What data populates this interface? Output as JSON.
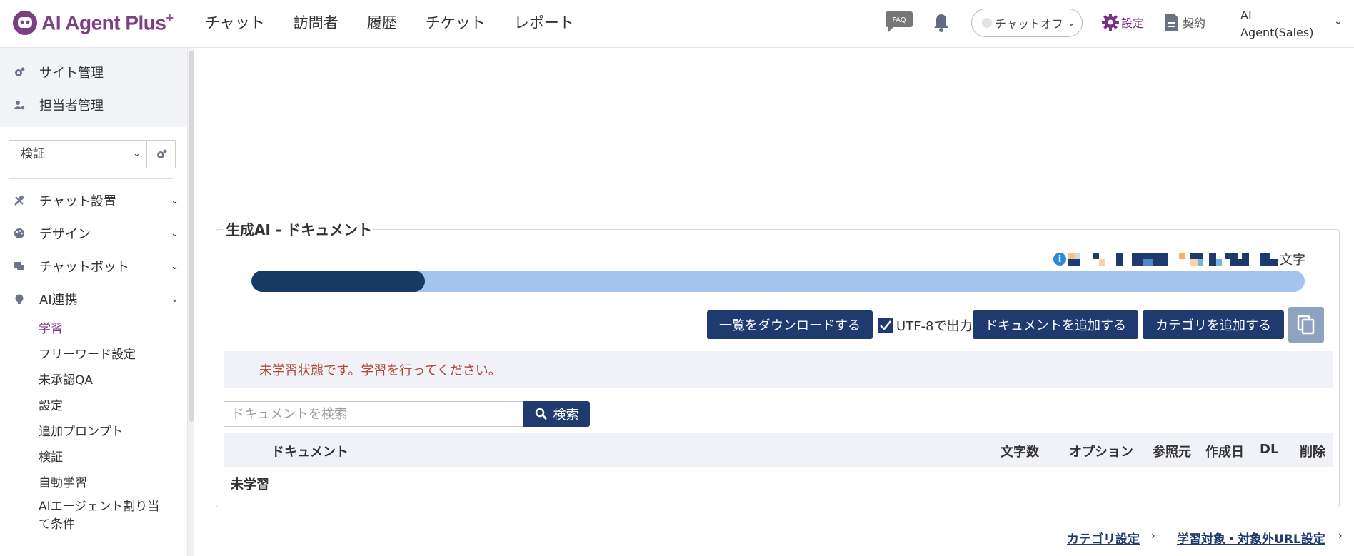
{
  "header": {
    "logo_text": "AI Agent Plus",
    "logo_sup": "+",
    "nav": [
      "チャット",
      "訪問者",
      "履歴",
      "チケット",
      "レポート"
    ],
    "faq_label": "FAQ",
    "chat_status": "チャットオフ",
    "settings_label": "設定",
    "contract_label": "契約",
    "user_line1": "AI",
    "user_line2": "Agent(Sales)"
  },
  "sidebar": {
    "top_items": [
      {
        "label": "サイト管理",
        "icon": "gear-cog-icon"
      },
      {
        "label": "担当者管理",
        "icon": "user-gear-icon"
      }
    ],
    "site_select_value": "検証",
    "sections": [
      {
        "label": "チャット設置",
        "icon": "tools-icon"
      },
      {
        "label": "デザイン",
        "icon": "palette-icon"
      },
      {
        "label": "チャットボット",
        "icon": "chat-bubbles-icon"
      },
      {
        "label": "AI連携",
        "icon": "bulb-icon"
      }
    ],
    "ai_sub_items": [
      {
        "label": "学習",
        "active": true
      },
      {
        "label": "フリーワード設定",
        "active": false
      },
      {
        "label": "未承認QA",
        "active": false
      },
      {
        "label": "設定",
        "active": false
      },
      {
        "label": "追加プロンプト",
        "active": false
      },
      {
        "label": "検証",
        "active": false
      },
      {
        "label": "自動学習",
        "active": false
      },
      {
        "label": "AIエージェント割り当\nて条件",
        "active": false
      }
    ]
  },
  "main": {
    "section_title": "生成AI - ドキュメント",
    "usage_suffix": "文字",
    "progress_fraction": 0.165,
    "buttons": {
      "download": "一覧をダウンロードする",
      "utf8_label": "UTF-8で出力",
      "utf8_checked": true,
      "add_document": "ドキュメントを追加する",
      "add_category": "カテゴリを追加する"
    },
    "notice": "未学習状態です。学習を行ってください。",
    "search": {
      "placeholder": "ドキュメントを検索",
      "button": "検索"
    },
    "table": {
      "headers": [
        "ドキュメント",
        "文字数",
        "オプション",
        "参照元",
        "作成日",
        "DL",
        "削除"
      ],
      "group_row": "未学習"
    },
    "links": [
      "カテゴリ設定",
      "学習対象・対象外URL設定"
    ]
  },
  "colors": {
    "brand_purple": "#7b3f82",
    "navy": "#1e3a6e",
    "progress_fill": "#173a63",
    "progress_track": "#a3c4ec",
    "notice_text": "#b0473a"
  }
}
